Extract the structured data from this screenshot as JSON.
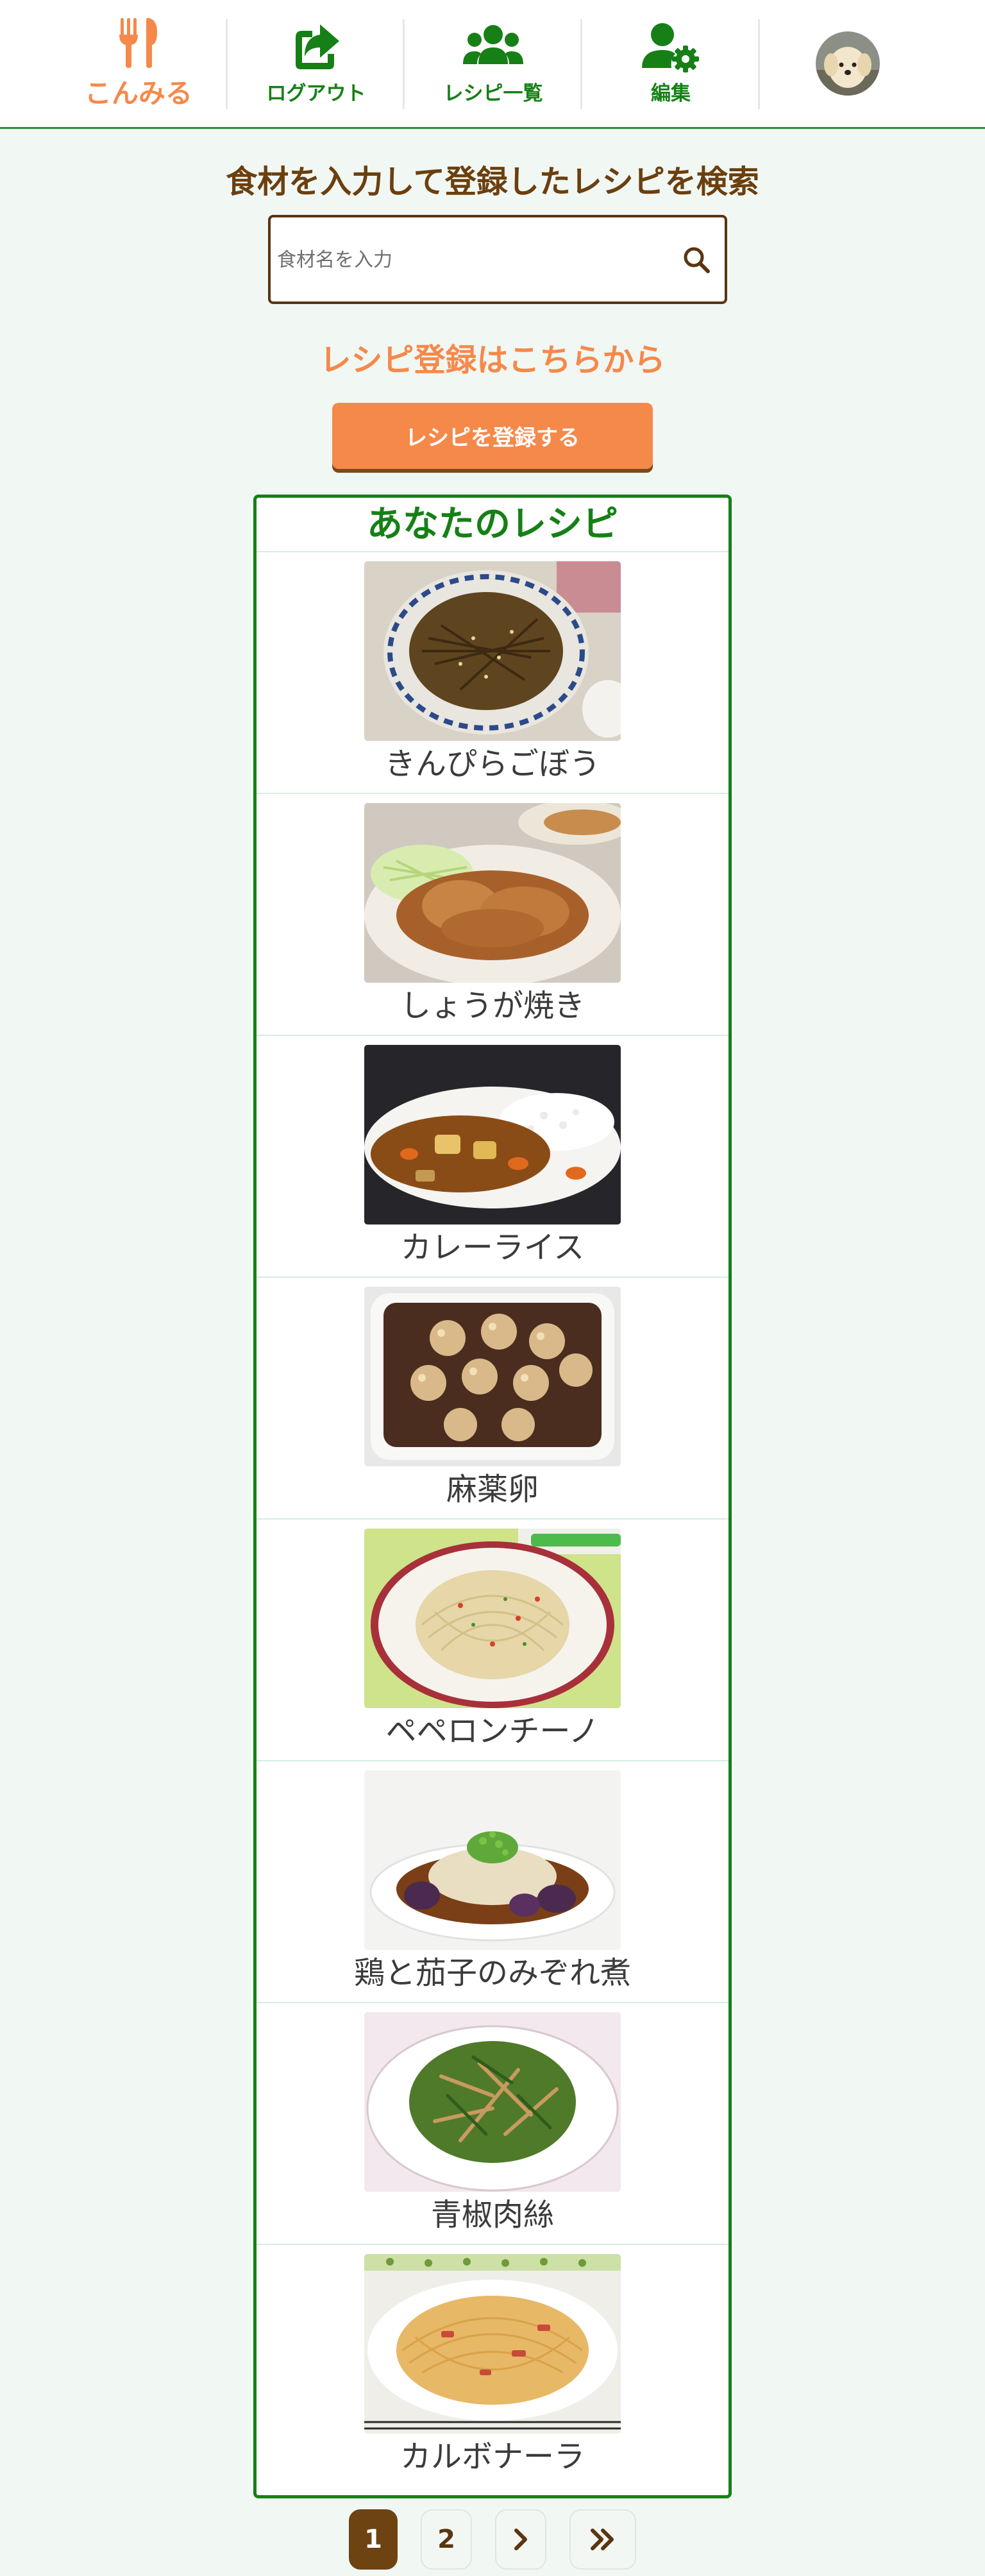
{
  "nav": {
    "brand_label": "こんみる",
    "logout_label": "ログアウト",
    "recipe_list_label": "レシピ一覧",
    "edit_label": "編集",
    "accent_color": "#f5894a",
    "nav_color": "#168016"
  },
  "search": {
    "title": "食材を入力して登録したレシピを検索",
    "placeholder": "食材名を入力",
    "value": ""
  },
  "register": {
    "heading": "レシピ登録はこちらから",
    "button_label": "レシピを登録する"
  },
  "recipes": {
    "title": "あなたのレシピ",
    "items": [
      {
        "name": "きんぴらごぼう"
      },
      {
        "name": "しょうが焼き"
      },
      {
        "name": "カレーライス"
      },
      {
        "name": "麻薬卵"
      },
      {
        "name": "ペペロンチーノ"
      },
      {
        "name": "鶏と茄子のみぞれ煮"
      },
      {
        "name": "青椒肉絲"
      },
      {
        "name": "カルボナーラ"
      }
    ]
  },
  "pagination": {
    "pages": [
      "1",
      "2"
    ],
    "current": "1",
    "next_icon": "chevron-right-icon",
    "last_icon": "double-chevron-right-icon"
  }
}
